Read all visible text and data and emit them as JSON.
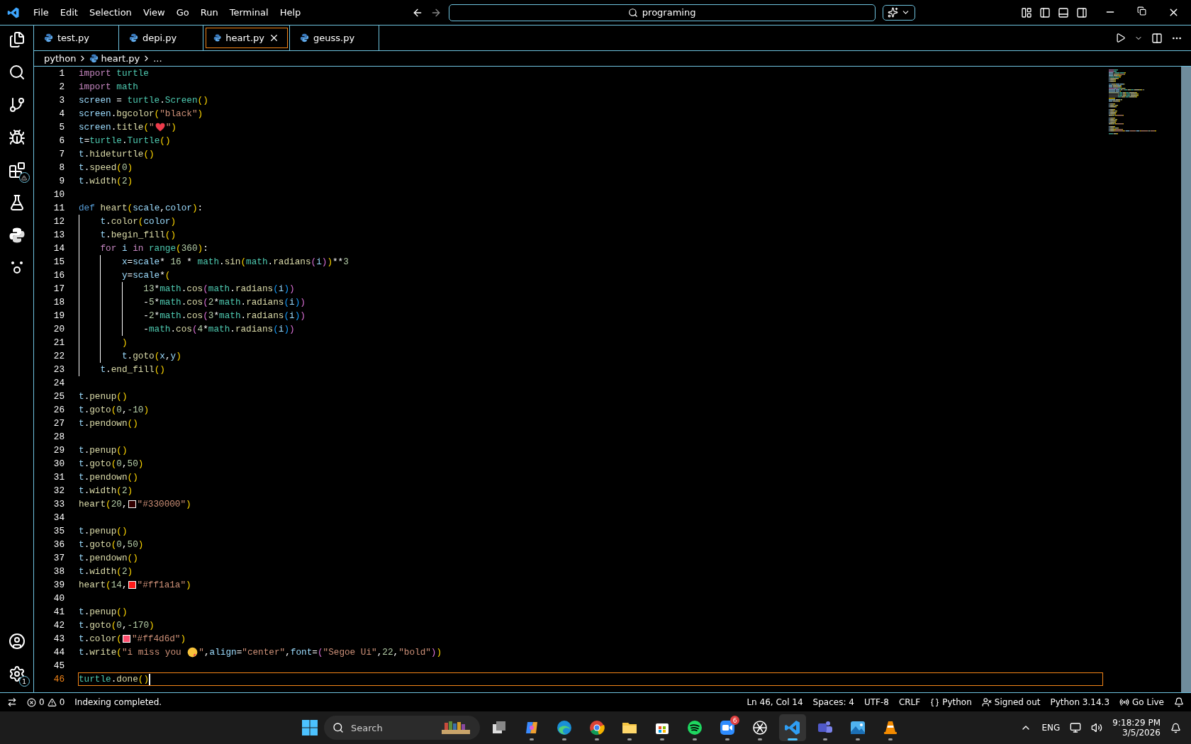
{
  "title_bar": {
    "menu": [
      "File",
      "Edit",
      "Selection",
      "View",
      "Go",
      "Run",
      "Terminal",
      "Help"
    ],
    "search": {
      "value": "programing"
    }
  },
  "tabs": [
    {
      "label": "test.py",
      "selected": false
    },
    {
      "label": "depi.py",
      "selected": false
    },
    {
      "label": "heart.py",
      "selected": true
    },
    {
      "label": "geuss.py",
      "selected": false
    }
  ],
  "breadcrumb": {
    "folder": "python",
    "file": "heart.py",
    "more": "..."
  },
  "activity_bar": {
    "settings_badge": "1"
  },
  "editor": {
    "lines": [
      {
        "number": "1",
        "current": false,
        "tokens": [
          {
            "kind": "keyword",
            "text": "import "
          },
          {
            "kind": "module",
            "text": "turtle"
          }
        ]
      },
      {
        "number": "2",
        "current": false,
        "tokens": [
          {
            "kind": "keyword",
            "text": "import "
          },
          {
            "kind": "module",
            "text": "math"
          }
        ]
      },
      {
        "number": "3",
        "current": false,
        "tokens": [
          {
            "kind": "var",
            "text": "screen"
          },
          {
            "kind": "op",
            "text": " = "
          },
          {
            "kind": "module",
            "text": "turtle"
          },
          {
            "kind": "op",
            "text": "."
          },
          {
            "kind": "module",
            "text": "Screen"
          },
          {
            "kind": "bracket",
            "text": "("
          },
          {
            "kind": "bracket",
            "text": ")"
          }
        ]
      },
      {
        "number": "4",
        "current": false,
        "tokens": [
          {
            "kind": "var",
            "text": "screen"
          },
          {
            "kind": "op",
            "text": "."
          },
          {
            "kind": "func",
            "text": "bgcolor"
          },
          {
            "kind": "bracket",
            "text": "("
          },
          {
            "kind": "string",
            "text": "\"black\""
          },
          {
            "kind": "bracket",
            "text": ")"
          }
        ]
      },
      {
        "number": "5",
        "current": false,
        "tokens": [
          {
            "kind": "var",
            "text": "screen"
          },
          {
            "kind": "op",
            "text": "."
          },
          {
            "kind": "func",
            "text": "title"
          },
          {
            "kind": "bracket",
            "text": "("
          },
          {
            "kind": "string",
            "text": "\""
          },
          {
            "kind": "heart"
          },
          {
            "kind": "string",
            "text": "\""
          },
          {
            "kind": "bracket",
            "text": ")"
          }
        ]
      },
      {
        "number": "6",
        "current": false,
        "tokens": [
          {
            "kind": "var",
            "text": "t"
          },
          {
            "kind": "op",
            "text": "="
          },
          {
            "kind": "module",
            "text": "turtle"
          },
          {
            "kind": "op",
            "text": "."
          },
          {
            "kind": "module",
            "text": "Turtle"
          },
          {
            "kind": "bracket",
            "text": "("
          },
          {
            "kind": "bracket",
            "text": ")"
          }
        ]
      },
      {
        "number": "7",
        "current": false,
        "tokens": [
          {
            "kind": "var",
            "text": "t"
          },
          {
            "kind": "op",
            "text": "."
          },
          {
            "kind": "func",
            "text": "hideturtle"
          },
          {
            "kind": "bracket",
            "text": "("
          },
          {
            "kind": "bracket",
            "text": ")"
          }
        ]
      },
      {
        "number": "8",
        "current": false,
        "tokens": [
          {
            "kind": "var",
            "text": "t"
          },
          {
            "kind": "op",
            "text": "."
          },
          {
            "kind": "func",
            "text": "speed"
          },
          {
            "kind": "bracket",
            "text": "("
          },
          {
            "kind": "number",
            "text": "0"
          },
          {
            "kind": "bracket",
            "text": ")"
          }
        ]
      },
      {
        "number": "9",
        "current": false,
        "tokens": [
          {
            "kind": "var",
            "text": "t"
          },
          {
            "kind": "op",
            "text": "."
          },
          {
            "kind": "func",
            "text": "width"
          },
          {
            "kind": "bracket",
            "text": "("
          },
          {
            "kind": "number",
            "text": "2"
          },
          {
            "kind": "bracket",
            "text": ")"
          }
        ]
      },
      {
        "number": "10",
        "current": false
      },
      {
        "number": "11",
        "current": false,
        "tokens": [
          {
            "kind": "def",
            "text": "def "
          },
          {
            "kind": "func",
            "text": "heart"
          },
          {
            "kind": "bracket",
            "text": "("
          },
          {
            "kind": "var",
            "text": "scale"
          },
          {
            "kind": "op",
            "text": ","
          },
          {
            "kind": "var",
            "text": "color"
          },
          {
            "kind": "bracket",
            "text": ")"
          },
          {
            "kind": "op",
            "text": ":"
          }
        ]
      },
      {
        "number": "12",
        "current": false,
        "tokens": [
          {
            "kind": "var",
            "text": "    t"
          },
          {
            "kind": "op",
            "text": "."
          },
          {
            "kind": "func",
            "text": "color"
          },
          {
            "kind": "bracket",
            "text": "("
          },
          {
            "kind": "var",
            "text": "color"
          },
          {
            "kind": "bracket",
            "text": ")"
          }
        ]
      },
      {
        "number": "13",
        "current": false,
        "tokens": [
          {
            "kind": "var",
            "text": "    t"
          },
          {
            "kind": "op",
            "text": "."
          },
          {
            "kind": "func",
            "text": "begin_fill"
          },
          {
            "kind": "bracket",
            "text": "("
          },
          {
            "kind": "bracket",
            "text": ")"
          }
        ]
      },
      {
        "number": "14",
        "current": false,
        "tokens": [
          {
            "kind": "keyword",
            "text": "    for "
          },
          {
            "kind": "var",
            "text": "i "
          },
          {
            "kind": "keyword",
            "text": "in "
          },
          {
            "kind": "module",
            "text": "range"
          },
          {
            "kind": "bracket",
            "text": "("
          },
          {
            "kind": "number",
            "text": "360"
          },
          {
            "kind": "bracket",
            "text": ")"
          },
          {
            "kind": "op",
            "text": ":"
          }
        ]
      },
      {
        "number": "15",
        "current": false,
        "tokens": [
          {
            "kind": "var",
            "text": "        x"
          },
          {
            "kind": "op",
            "text": "="
          },
          {
            "kind": "var",
            "text": "scale"
          },
          {
            "kind": "op",
            "text": "* "
          },
          {
            "kind": "number",
            "text": "16"
          },
          {
            "kind": "op",
            "text": " * "
          },
          {
            "kind": "module",
            "text": "math"
          },
          {
            "kind": "op",
            "text": "."
          },
          {
            "kind": "func",
            "text": "sin"
          },
          {
            "kind": "bracket",
            "text": "("
          },
          {
            "kind": "module",
            "text": "math"
          },
          {
            "kind": "op",
            "text": "."
          },
          {
            "kind": "func",
            "text": "radians"
          },
          {
            "kind": "bracket",
            "text": "("
          },
          {
            "kind": "var",
            "text": "i"
          },
          {
            "kind": "bracket",
            "text": ")"
          },
          {
            "kind": "bracket",
            "text": ")"
          },
          {
            "kind": "op",
            "text": "**"
          },
          {
            "kind": "number",
            "text": "3"
          }
        ]
      },
      {
        "number": "16",
        "current": false,
        "tokens": [
          {
            "kind": "var",
            "text": "        y"
          },
          {
            "kind": "op",
            "text": "="
          },
          {
            "kind": "var",
            "text": "scale"
          },
          {
            "kind": "op",
            "text": "*"
          },
          {
            "kind": "bracket",
            "text": "("
          }
        ]
      },
      {
        "number": "17",
        "current": false,
        "tokens": [
          {
            "kind": "number",
            "text": "            13"
          },
          {
            "kind": "op",
            "text": "*"
          },
          {
            "kind": "module",
            "text": "math"
          },
          {
            "kind": "op",
            "text": "."
          },
          {
            "kind": "func",
            "text": "cos"
          },
          {
            "kind": "bracket",
            "text": "("
          },
          {
            "kind": "module",
            "text": "math"
          },
          {
            "kind": "op",
            "text": "."
          },
          {
            "kind": "func",
            "text": "radians"
          },
          {
            "kind": "bracket",
            "text": "("
          },
          {
            "kind": "var",
            "text": "i"
          },
          {
            "kind": "bracket",
            "text": ")"
          },
          {
            "kind": "bracket",
            "text": ")"
          }
        ]
      },
      {
        "number": "18",
        "current": false,
        "tokens": [
          {
            "kind": "op",
            "text": "            -"
          },
          {
            "kind": "number",
            "text": "5"
          },
          {
            "kind": "op",
            "text": "*"
          },
          {
            "kind": "module",
            "text": "math"
          },
          {
            "kind": "op",
            "text": "."
          },
          {
            "kind": "func",
            "text": "cos"
          },
          {
            "kind": "bracket",
            "text": "("
          },
          {
            "kind": "number",
            "text": "2"
          },
          {
            "kind": "op",
            "text": "*"
          },
          {
            "kind": "module",
            "text": "math"
          },
          {
            "kind": "op",
            "text": "."
          },
          {
            "kind": "func",
            "text": "radians"
          },
          {
            "kind": "bracket",
            "text": "("
          },
          {
            "kind": "var",
            "text": "i"
          },
          {
            "kind": "bracket",
            "text": ")"
          },
          {
            "kind": "bracket",
            "text": ")"
          }
        ]
      },
      {
        "number": "19",
        "current": false,
        "tokens": [
          {
            "kind": "op",
            "text": "            -"
          },
          {
            "kind": "number",
            "text": "2"
          },
          {
            "kind": "op",
            "text": "*"
          },
          {
            "kind": "module",
            "text": "math"
          },
          {
            "kind": "op",
            "text": "."
          },
          {
            "kind": "func",
            "text": "cos"
          },
          {
            "kind": "bracket",
            "text": "("
          },
          {
            "kind": "number",
            "text": "3"
          },
          {
            "kind": "op",
            "text": "*"
          },
          {
            "kind": "module",
            "text": "math"
          },
          {
            "kind": "op",
            "text": "."
          },
          {
            "kind": "func",
            "text": "radians"
          },
          {
            "kind": "bracket",
            "text": "("
          },
          {
            "kind": "var",
            "text": "i"
          },
          {
            "kind": "bracket",
            "text": ")"
          },
          {
            "kind": "bracket",
            "text": ")"
          }
        ]
      },
      {
        "number": "20",
        "current": false,
        "tokens": [
          {
            "kind": "op",
            "text": "            -"
          },
          {
            "kind": "module",
            "text": "math"
          },
          {
            "kind": "op",
            "text": "."
          },
          {
            "kind": "func",
            "text": "cos"
          },
          {
            "kind": "bracket",
            "text": "("
          },
          {
            "kind": "number",
            "text": "4"
          },
          {
            "kind": "op",
            "text": "*"
          },
          {
            "kind": "module",
            "text": "math"
          },
          {
            "kind": "op",
            "text": "."
          },
          {
            "kind": "func",
            "text": "radians"
          },
          {
            "kind": "bracket",
            "text": "("
          },
          {
            "kind": "var",
            "text": "i"
          },
          {
            "kind": "bracket",
            "text": ")"
          },
          {
            "kind": "bracket",
            "text": ")"
          }
        ]
      },
      {
        "number": "21",
        "current": false,
        "tokens": [
          {
            "kind": "bracket",
            "text": "        )"
          }
        ]
      },
      {
        "number": "22",
        "current": false,
        "tokens": [
          {
            "kind": "var",
            "text": "        t"
          },
          {
            "kind": "op",
            "text": "."
          },
          {
            "kind": "func",
            "text": "goto"
          },
          {
            "kind": "bracket",
            "text": "("
          },
          {
            "kind": "var",
            "text": "x"
          },
          {
            "kind": "op",
            "text": ","
          },
          {
            "kind": "var",
            "text": "y"
          },
          {
            "kind": "bracket",
            "text": ")"
          }
        ]
      },
      {
        "number": "23",
        "current": false,
        "tokens": [
          {
            "kind": "var",
            "text": "    t"
          },
          {
            "kind": "op",
            "text": "."
          },
          {
            "kind": "func",
            "text": "end_fill"
          },
          {
            "kind": "bracket",
            "text": "("
          },
          {
            "kind": "bracket",
            "text": ")"
          }
        ]
      },
      {
        "number": "24",
        "current": false
      },
      {
        "number": "25",
        "current": false,
        "tokens": [
          {
            "kind": "var",
            "text": "t"
          },
          {
            "kind": "op",
            "text": "."
          },
          {
            "kind": "func",
            "text": "penup"
          },
          {
            "kind": "bracket",
            "text": "("
          },
          {
            "kind": "bracket",
            "text": ")"
          }
        ]
      },
      {
        "number": "26",
        "current": false,
        "tokens": [
          {
            "kind": "var",
            "text": "t"
          },
          {
            "kind": "op",
            "text": "."
          },
          {
            "kind": "func",
            "text": "goto"
          },
          {
            "kind": "bracket",
            "text": "("
          },
          {
            "kind": "number",
            "text": "0"
          },
          {
            "kind": "op",
            "text": ","
          },
          {
            "kind": "number",
            "text": "-10"
          },
          {
            "kind": "bracket",
            "text": ")"
          }
        ]
      },
      {
        "number": "27",
        "current": false,
        "tokens": [
          {
            "kind": "var",
            "text": "t"
          },
          {
            "kind": "op",
            "text": "."
          },
          {
            "kind": "func",
            "text": "pendown"
          },
          {
            "kind": "bracket",
            "text": "("
          },
          {
            "kind": "bracket",
            "text": ")"
          }
        ]
      },
      {
        "number": "28",
        "current": false
      },
      {
        "number": "29",
        "current": false,
        "tokens": [
          {
            "kind": "var",
            "text": "t"
          },
          {
            "kind": "op",
            "text": "."
          },
          {
            "kind": "func",
            "text": "penup"
          },
          {
            "kind": "bracket",
            "text": "("
          },
          {
            "kind": "bracket",
            "text": ")"
          }
        ]
      },
      {
        "number": "30",
        "current": false,
        "tokens": [
          {
            "kind": "var",
            "text": "t"
          },
          {
            "kind": "op",
            "text": "."
          },
          {
            "kind": "func",
            "text": "goto"
          },
          {
            "kind": "bracket",
            "text": "("
          },
          {
            "kind": "number",
            "text": "0"
          },
          {
            "kind": "op",
            "text": ","
          },
          {
            "kind": "number",
            "text": "50"
          },
          {
            "kind": "bracket",
            "text": ")"
          }
        ]
      },
      {
        "number": "31",
        "current": false,
        "tokens": [
          {
            "kind": "var",
            "text": "t"
          },
          {
            "kind": "op",
            "text": "."
          },
          {
            "kind": "func",
            "text": "pendown"
          },
          {
            "kind": "bracket",
            "text": "("
          },
          {
            "kind": "bracket",
            "text": ")"
          }
        ]
      },
      {
        "number": "32",
        "current": false,
        "tokens": [
          {
            "kind": "var",
            "text": "t"
          },
          {
            "kind": "op",
            "text": "."
          },
          {
            "kind": "func",
            "text": "width"
          },
          {
            "kind": "bracket",
            "text": "("
          },
          {
            "kind": "number",
            "text": "2"
          },
          {
            "kind": "bracket",
            "text": ")"
          }
        ]
      },
      {
        "number": "33",
        "current": false,
        "tokens": [
          {
            "kind": "func",
            "text": "heart"
          },
          {
            "kind": "bracket",
            "text": "("
          },
          {
            "kind": "number",
            "text": "20"
          },
          {
            "kind": "op",
            "text": ","
          },
          {
            "kind": "swatch",
            "color": "#330000"
          },
          {
            "kind": "string",
            "text": "\"#330000\""
          },
          {
            "kind": "bracket",
            "text": ")"
          }
        ]
      },
      {
        "number": "34",
        "current": false
      },
      {
        "number": "35",
        "current": false,
        "tokens": [
          {
            "kind": "var",
            "text": "t"
          },
          {
            "kind": "op",
            "text": "."
          },
          {
            "kind": "func",
            "text": "penup"
          },
          {
            "kind": "bracket",
            "text": "("
          },
          {
            "kind": "bracket",
            "text": ")"
          }
        ]
      },
      {
        "number": "36",
        "current": false,
        "tokens": [
          {
            "kind": "var",
            "text": "t"
          },
          {
            "kind": "op",
            "text": "."
          },
          {
            "kind": "func",
            "text": "goto"
          },
          {
            "kind": "bracket",
            "text": "("
          },
          {
            "kind": "number",
            "text": "0"
          },
          {
            "kind": "op",
            "text": ","
          },
          {
            "kind": "number",
            "text": "50"
          },
          {
            "kind": "bracket",
            "text": ")"
          }
        ]
      },
      {
        "number": "37",
        "current": false,
        "tokens": [
          {
            "kind": "var",
            "text": "t"
          },
          {
            "kind": "op",
            "text": "."
          },
          {
            "kind": "func",
            "text": "pendown"
          },
          {
            "kind": "bracket",
            "text": "("
          },
          {
            "kind": "bracket",
            "text": ")"
          }
        ]
      },
      {
        "number": "38",
        "current": false,
        "tokens": [
          {
            "kind": "var",
            "text": "t"
          },
          {
            "kind": "op",
            "text": "."
          },
          {
            "kind": "func",
            "text": "width"
          },
          {
            "kind": "bracket",
            "text": "("
          },
          {
            "kind": "number",
            "text": "2"
          },
          {
            "kind": "bracket",
            "text": ")"
          }
        ]
      },
      {
        "number": "39",
        "current": false,
        "tokens": [
          {
            "kind": "func",
            "text": "heart"
          },
          {
            "kind": "bracket",
            "text": "("
          },
          {
            "kind": "number",
            "text": "14"
          },
          {
            "kind": "op",
            "text": ","
          },
          {
            "kind": "swatch",
            "color": "#ff1a1a"
          },
          {
            "kind": "string",
            "text": "\"#ff1a1a\""
          },
          {
            "kind": "bracket",
            "text": ")"
          }
        ]
      },
      {
        "number": "40",
        "current": false
      },
      {
        "number": "41",
        "current": false,
        "tokens": [
          {
            "kind": "var",
            "text": "t"
          },
          {
            "kind": "op",
            "text": "."
          },
          {
            "kind": "func",
            "text": "penup"
          },
          {
            "kind": "bracket",
            "text": "("
          },
          {
            "kind": "bracket",
            "text": ")"
          }
        ]
      },
      {
        "number": "42",
        "current": false,
        "tokens": [
          {
            "kind": "var",
            "text": "t"
          },
          {
            "kind": "op",
            "text": "."
          },
          {
            "kind": "func",
            "text": "goto"
          },
          {
            "kind": "bracket",
            "text": "("
          },
          {
            "kind": "number",
            "text": "0"
          },
          {
            "kind": "op",
            "text": ","
          },
          {
            "kind": "number",
            "text": "-170"
          },
          {
            "kind": "bracket",
            "text": ")"
          }
        ]
      },
      {
        "number": "43",
        "current": false,
        "tokens": [
          {
            "kind": "var",
            "text": "t"
          },
          {
            "kind": "op",
            "text": "."
          },
          {
            "kind": "func",
            "text": "color"
          },
          {
            "kind": "bracket",
            "text": "("
          },
          {
            "kind": "swatch",
            "color": "#ff4d6d"
          },
          {
            "kind": "string",
            "text": "\"#ff4d6d\""
          },
          {
            "kind": "bracket",
            "text": ")"
          }
        ]
      },
      {
        "number": "44",
        "current": false,
        "tokens": [
          {
            "kind": "var",
            "text": "t"
          },
          {
            "kind": "op",
            "text": "."
          },
          {
            "kind": "func",
            "text": "write"
          },
          {
            "kind": "bracket",
            "text": "("
          },
          {
            "kind": "string",
            "text": "\"i miss you "
          },
          {
            "kind": "kiss"
          },
          {
            "kind": "string",
            "text": "\""
          },
          {
            "kind": "op",
            "text": ","
          },
          {
            "kind": "var",
            "text": "align"
          },
          {
            "kind": "op",
            "text": "="
          },
          {
            "kind": "string",
            "text": "\"center\""
          },
          {
            "kind": "op",
            "text": ","
          },
          {
            "kind": "var",
            "text": "font"
          },
          {
            "kind": "op",
            "text": "="
          },
          {
            "kind": "bracket",
            "text": "("
          },
          {
            "kind": "string",
            "text": "\"Segoe Ui\""
          },
          {
            "kind": "op",
            "text": ","
          },
          {
            "kind": "number",
            "text": "22"
          },
          {
            "kind": "op",
            "text": ","
          },
          {
            "kind": "string",
            "text": "\"bold\""
          },
          {
            "kind": "bracket",
            "text": ")"
          },
          {
            "kind": "bracket",
            "text": ")"
          }
        ]
      },
      {
        "number": "45",
        "current": false
      },
      {
        "number": "46",
        "current": true,
        "tokens": [
          {
            "kind": "module",
            "text": "turtle"
          },
          {
            "kind": "op",
            "text": "."
          },
          {
            "kind": "func",
            "text": "done"
          },
          {
            "kind": "bracket",
            "text": "("
          },
          {
            "kind": "bracket",
            "text": ")"
          }
        ]
      }
    ]
  },
  "status_bar": {
    "errors": "0",
    "warnings": "0",
    "message": "Indexing completed.",
    "position": "Ln 46, Col 14",
    "spaces": "Spaces: 4",
    "encoding": "UTF-8",
    "eol": "CRLF",
    "language": "Python",
    "account": "Signed out",
    "interpreter": "Python 3.14.3",
    "live": "Go Live"
  },
  "taskbar": {
    "search": {
      "placeholder": "Search"
    },
    "apps": [
      {
        "kind": "taskview",
        "selected": false
      },
      {
        "kind": "copilot",
        "selected": false
      },
      {
        "kind": "edge",
        "selected": false
      },
      {
        "kind": "chrome",
        "selected": false
      },
      {
        "kind": "files",
        "selected": false
      },
      {
        "kind": "store",
        "selected": false
      },
      {
        "kind": "spotify",
        "selected": false
      },
      {
        "kind": "zoom",
        "selected": false,
        "badge": "6"
      },
      {
        "kind": "chatgpt",
        "selected": false
      },
      {
        "kind": "vscode",
        "selected": true
      },
      {
        "kind": "teams",
        "selected": false
      },
      {
        "kind": "photos",
        "selected": false
      },
      {
        "kind": "vlc",
        "selected": false
      }
    ],
    "language": "ENG",
    "time": "9:18:29 PM",
    "date": "3/5/2026"
  }
}
